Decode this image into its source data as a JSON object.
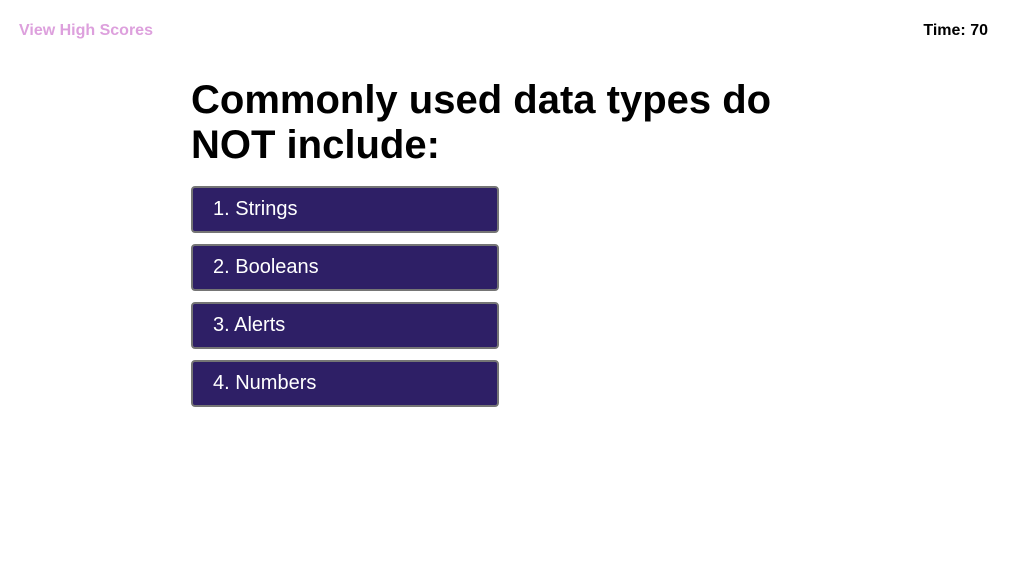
{
  "header": {
    "view_high_scores_label": "View High Scores",
    "timer_label": "Time: 70"
  },
  "quiz": {
    "question": "Commonly used data types do NOT include:",
    "choices": [
      {
        "label": "1. Strings"
      },
      {
        "label": "2. Booleans"
      },
      {
        "label": "3. Alerts"
      },
      {
        "label": "4. Numbers"
      }
    ]
  },
  "colors": {
    "link": "#dda0dd",
    "button_background": "#2e1f66",
    "button_text": "#ffffff",
    "text": "#000000",
    "background": "#ffffff"
  }
}
